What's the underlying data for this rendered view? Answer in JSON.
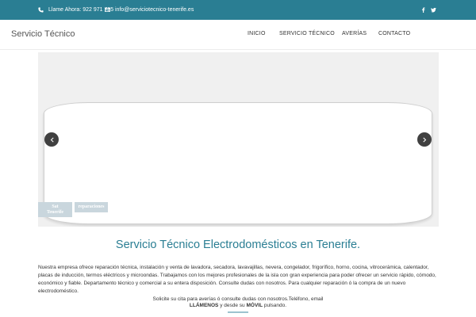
{
  "topbar": {
    "phone": "Llame Ahora: 922 971 795",
    "email": "info@serviciotecnico-tenerife.es",
    "icons": {
      "phone": "phone-icon",
      "email": "envelope-icon",
      "facebook": "facebook-icon",
      "twitter": "twitter-icon"
    },
    "color": "#2a7e93"
  },
  "header": {
    "logo": "Servicio Técnico",
    "nav": [
      "INICIO",
      "SERVICIO TÉCNICO",
      "AVERÍAS",
      "CONTACTO"
    ]
  },
  "slider": {
    "thumb_1": "Sat\nTenerife",
    "thumb_2": "reparaciones",
    "icons": {
      "prev": "chevron-left-icon",
      "next": "chevron-right-icon"
    }
  },
  "main": {
    "title": "Servicio Técnico Electrodomésticos en Tenerife.",
    "description": "Nuestra empresa ofrece reparación técnica, instalación y venta de lavadora, secadora, lavavajillas, nevera, congelador, frigorífico, horno, cocina, vitrocerámica, calentador, placas de inducción, termos eléctricos y microondas. Trabajamos con los mejores profesionales de la isla con gran experiencia para poder ofrecer un servicio rápido, cómodo, económico y fiable. Departamento técnico y comercial a su entera disposición. Consulte dudas con nosotros. Para cualquier reparación ó la compra de un nuevo electrodoméstico.",
    "cta_line_1": "Solicite su cita para averías ó consulte dudas con nosotros.Teléfono, email",
    "cta_call": "LLÁMENOS",
    "cta_mid": " y desde su ",
    "cta_mobile": "MÓVIL",
    "cta_end": " pulsando."
  }
}
